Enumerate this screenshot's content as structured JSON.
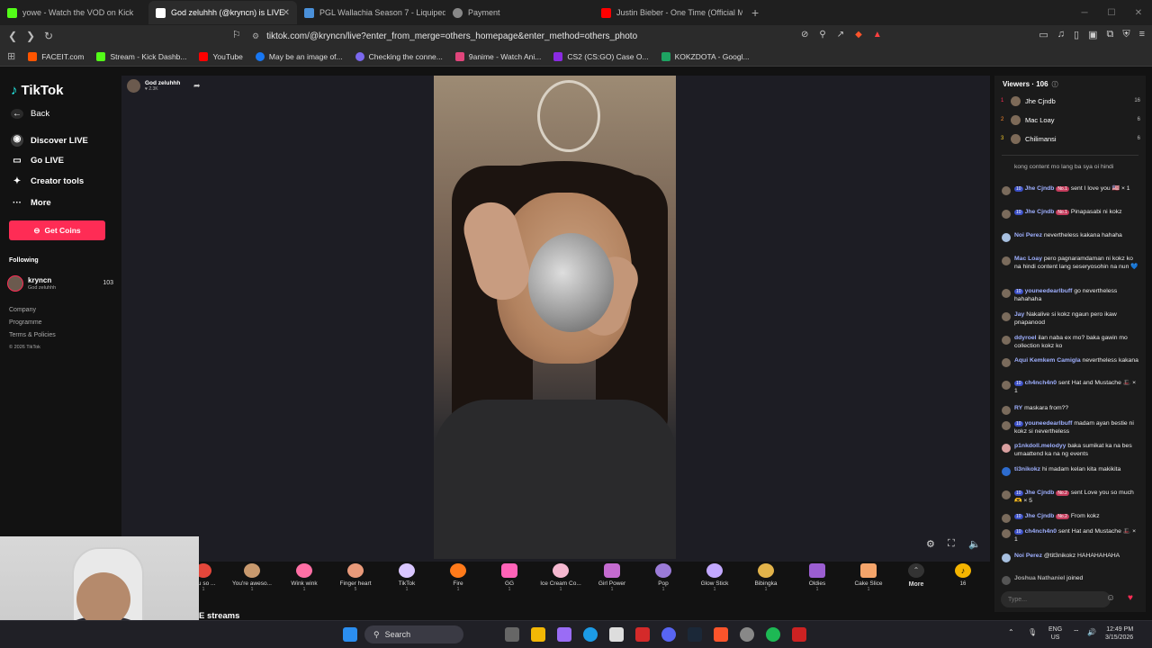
{
  "browser": {
    "tabs": [
      {
        "title": "yowe - Watch the VOD on Kick",
        "color": "#53fc18",
        "active": false
      },
      {
        "title": "God zeluhhh (@kryncn) is LIVE",
        "color": "#ffffff",
        "active": true
      },
      {
        "title": "PGL Wallachia Season 7 - Liquipedia",
        "color": "#4a90d9",
        "active": false
      },
      {
        "title": "Payment",
        "color": "#888888",
        "active": false
      },
      {
        "title": "Justin Bieber - One Time (Official Mu",
        "color": "#ff0000",
        "active": false
      }
    ],
    "url": "tiktok.com/@kryncn/live?enter_from_merge=others_homepage&enter_method=others_photo",
    "bookmarks": [
      {
        "label": "FACEIT.com",
        "color": "#ff5500"
      },
      {
        "label": "Stream - Kick Dashb...",
        "color": "#53fc18"
      },
      {
        "label": "YouTube",
        "color": "#ff0000"
      },
      {
        "label": "May be an image of...",
        "color": "#1877f2"
      },
      {
        "label": "Checking the conne...",
        "color": "#7b68ee"
      },
      {
        "label": "9anime - Watch Ani...",
        "color": "#e0457b"
      },
      {
        "label": "CS2 (CS:GO) Case O...",
        "color": "#8a2be2"
      },
      {
        "label": "KOKZDOTA - Googl...",
        "color": "#1ea362"
      }
    ]
  },
  "sidebar": {
    "logo": "TikTok",
    "back": "Back",
    "items": [
      "Discover LIVE",
      "Go LIVE",
      "Creator tools",
      "More"
    ],
    "get_coins": "Get Coins",
    "following_label": "Following",
    "following": {
      "name": "kryncn",
      "sub": "God zeluhhh",
      "count": "103"
    },
    "footer": [
      "Company",
      "Programme",
      "Terms & Policies",
      "© 2026 TikTok"
    ]
  },
  "stage": {
    "host_name": "God zeluhhh",
    "host_likes": "♥ 2.3K"
  },
  "gifts": [
    {
      "name": "You so ...",
      "cost": "1"
    },
    {
      "name": "You're aweso...",
      "cost": "1"
    },
    {
      "name": "Wink wink",
      "cost": "1"
    },
    {
      "name": "Finger heart",
      "cost": "5"
    },
    {
      "name": "TikTok",
      "cost": "1"
    },
    {
      "name": "Fire",
      "cost": "1"
    },
    {
      "name": "GG",
      "cost": "1"
    },
    {
      "name": "Ice Cream Co...",
      "cost": "1"
    },
    {
      "name": "Girl Power",
      "cost": "1"
    },
    {
      "name": "Pop",
      "cost": "1"
    },
    {
      "name": "Glow Stick",
      "cost": "1"
    },
    {
      "name": "Bibingka",
      "cost": "1"
    },
    {
      "name": "Oldies",
      "cost": "1"
    },
    {
      "name": "Cake Slice",
      "cost": "1"
    }
  ],
  "gift_more": "More",
  "coin_balance": "16",
  "live_streams_label": "E streams",
  "panel": {
    "viewers_label": "Viewers · 106",
    "top_viewers": [
      {
        "rank": "1",
        "name": "Jhe Cjndb",
        "count": "16"
      },
      {
        "rank": "2",
        "name": "Mac Loay",
        "count": "6"
      },
      {
        "rank": "3",
        "name": "Chilimansi",
        "count": "6"
      }
    ],
    "chat": [
      {
        "user": "",
        "text": "kong content mo lang ba sya oi hindi"
      },
      {
        "user": "Jhe Cjndb",
        "badge": "No.1",
        "text": "sent I love you 🇺🇸 × 1"
      },
      {
        "user": "Jhe Cjndb",
        "badge": "No.1",
        "text": "Pinapasabi ni kokz"
      },
      {
        "user": "Noi Perez",
        "text": "nevertheless kakana hahaha"
      },
      {
        "user": "Mac Loay",
        "text": "pero pagnaramdaman ni kokz ko na hindi content lang seseryosohin na nun 💙"
      },
      {
        "user": "youneedearlbuff",
        "text": "go nevertheless hahahaha"
      },
      {
        "user": "Jay",
        "text": "Nakalive si kokz ngaun pero ikaw pnapanood"
      },
      {
        "user": "ddyroel",
        "text": "ilan naba ex mo? baka gawin mo collection kokz ko"
      },
      {
        "user": "Aqui Kemkem Camigla",
        "text": "nevertheless kakana"
      },
      {
        "user": "ch4nch4n0",
        "text": "sent Hat and Mustache 🎩 × 1"
      },
      {
        "user": "RY",
        "text": "maskara from??"
      },
      {
        "user": "youneedearlbuff",
        "text": "madam ayan bestie ni kokz si nevertheless"
      },
      {
        "user": "p1nkdoll.melodyy",
        "text": "baka sumikat ka na bes umaattend ka na ng events"
      },
      {
        "user": "ti3nikokz",
        "text": "hi madam kelan kita makikita"
      },
      {
        "user": "Jhe Cjndb",
        "badge": "No.2",
        "text": "sent Love you so much 🫶 × 5"
      },
      {
        "user": "Jhe Cjndb",
        "badge": "No.2",
        "text": "From kokz"
      },
      {
        "user": "ch4nch4n0",
        "text": "sent Hat and Mustache 🎩 × 1"
      },
      {
        "user": "Noi Perez",
        "text": "@tit3nikokz HAHAHAHAHA"
      },
      {
        "user": "Joshua Nathaniel",
        "text": "joined"
      }
    ],
    "input_placeholder": "Type..."
  },
  "taskbar": {
    "search": "Search",
    "lang": "ENG",
    "region": "US",
    "time": "12:49 PM",
    "date": "3/15/2026"
  }
}
